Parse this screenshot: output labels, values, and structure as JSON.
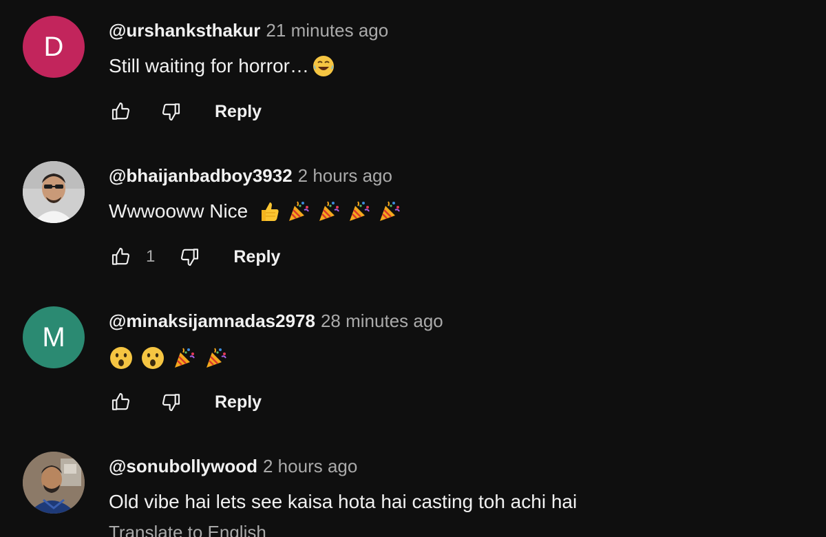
{
  "comments": [
    {
      "author": "@urshanksthakur",
      "time": "21 minutes ago",
      "text": "Still waiting for horror…",
      "text_emojis": [
        "laughing-tears"
      ],
      "avatar_letter": "D",
      "avatar_color": "#c2255c",
      "likes": "",
      "reply_label": "Reply"
    },
    {
      "author": "@bhaijanbadboy3932",
      "time": "2 hours ago",
      "text": "Wwwooww Nice",
      "text_emojis": [
        "thumbs-up",
        "party-popper",
        "party-popper",
        "party-popper",
        "party-popper"
      ],
      "avatar_letter": "",
      "avatar_color": "#d0d0d0",
      "likes": "1",
      "reply_label": "Reply"
    },
    {
      "author": "@minaksijamnadas2978",
      "time": "28 minutes ago",
      "text": "",
      "text_emojis": [
        "astonished",
        "astonished",
        "party-popper",
        "party-popper"
      ],
      "avatar_letter": "M",
      "avatar_color": "#2b8a72",
      "likes": "",
      "reply_label": "Reply"
    },
    {
      "author": "@sonubollywood",
      "time": "2 hours ago",
      "text": "Old vibe hai lets see kaisa hota hai casting toh achi hai",
      "text_emojis": [],
      "avatar_letter": "",
      "avatar_color": "#7a6a5c",
      "likes": "",
      "reply_label": ""
    }
  ],
  "translate_label": "Translate to English",
  "icons": {
    "like": "thumb-up-outline-icon",
    "dislike": "thumb-down-outline-icon"
  },
  "colors": {
    "background": "#0f0f0f",
    "text_primary": "#f1f1f1",
    "text_secondary": "#aaaaaa"
  }
}
